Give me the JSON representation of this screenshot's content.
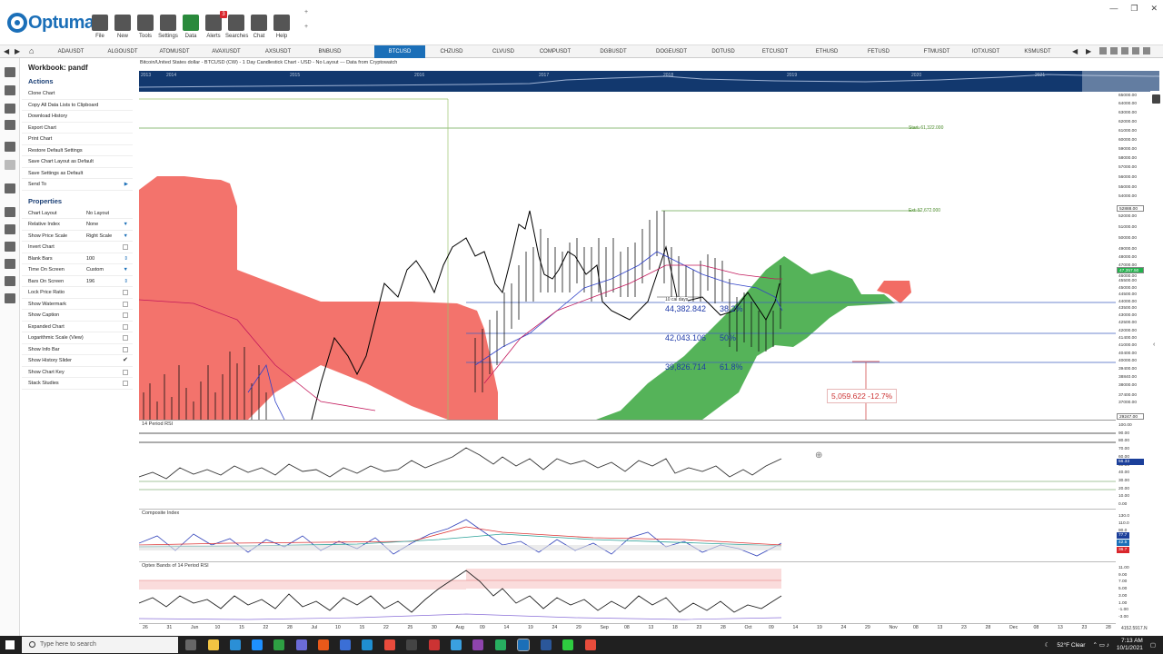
{
  "app": {
    "name": "Optuma"
  },
  "toolbar": {
    "buttons": [
      {
        "label": "File",
        "icon": "folder-icon"
      },
      {
        "label": "New",
        "icon": "new-page-icon"
      },
      {
        "label": "Tools",
        "icon": "tools-icon"
      },
      {
        "label": "Settings",
        "icon": "gear-icon"
      },
      {
        "label": "Data",
        "icon": "data-grid-icon"
      },
      {
        "label": "Alerts",
        "icon": "alarm-clock-icon"
      },
      {
        "label": "Searches",
        "icon": "magnifier-icon"
      },
      {
        "label": "Chat",
        "icon": "chat-bubble-icon"
      },
      {
        "label": "Help",
        "icon": "question-icon"
      }
    ],
    "alerts_count": "3"
  },
  "symbols": [
    "ADAUSDT",
    "ALGOUSDT",
    "ATOMUSDT",
    "AVAXUSDT",
    "AXSUSDT",
    "BNBUSD",
    "BTCUSD",
    "CHZUSD",
    "CLVUSD",
    "COMPUSDT",
    "DGBUSDT",
    "DOGEUSDT",
    "DOTUSD",
    "ETCUSDT",
    "ETHUSD",
    "FETUSD",
    "FTMUSDT",
    "IOTXUSDT",
    "KSMUSDT"
  ],
  "active_symbol": "BTCUSD",
  "panel": {
    "workbook": "Workbook: pandf",
    "actions_heading": "Actions",
    "actions": [
      "Clone Chart",
      "Copy All Data Lists to Clipboard",
      "Download History",
      "Export Chart",
      "Print Chart",
      "Restore Default Settings",
      "Save Chart Layout as Default",
      "Save Settings as Default",
      "Send To"
    ],
    "properties_heading": "Properties",
    "properties": [
      {
        "label": "Chart Layout",
        "value": "No Layout",
        "control": "text"
      },
      {
        "label": "Relative Index",
        "value": "None",
        "control": "dropdown"
      },
      {
        "label": "Show Price Scale",
        "value": "Right Scale",
        "control": "dropdown"
      },
      {
        "label": "Invert Chart",
        "value": "",
        "control": "checkbox",
        "checked": false
      },
      {
        "label": "Blank Bars",
        "value": "100",
        "control": "spinner"
      },
      {
        "label": "Time On Screen",
        "value": "Custom",
        "control": "dropdown"
      },
      {
        "label": "Bars On Screen",
        "value": "196",
        "control": "spinner"
      },
      {
        "label": "Lock Price Ratio",
        "value": "",
        "control": "checkbox",
        "checked": false
      },
      {
        "label": "Show Watermark",
        "value": "",
        "control": "checkbox",
        "checked": false
      },
      {
        "label": "Show Caption",
        "value": "",
        "control": "checkbox",
        "checked": false
      },
      {
        "label": "Expanded Chart",
        "value": "",
        "control": "checkbox",
        "checked": false
      },
      {
        "label": "Logarithmic Scale (View)",
        "value": "",
        "control": "checkbox",
        "checked": false
      },
      {
        "label": "Show Info Bar",
        "value": "",
        "control": "checkbox",
        "checked": false
      },
      {
        "label": "Show History Slider",
        "value": "",
        "control": "checkbox",
        "checked": true
      },
      {
        "label": "Show Chart Key",
        "value": "",
        "control": "checkbox",
        "checked": false
      },
      {
        "label": "Stack Studies",
        "value": "",
        "control": "checkbox",
        "checked": false
      }
    ]
  },
  "chart": {
    "header": "Bitcoin/United States dollar - BTCUSD (CW) - 1 Day Candlestick Chart - USD - No Layout --- Data from Cryptowatch",
    "history_years": [
      "2013",
      "2014",
      "2015",
      "2016",
      "2017",
      "2018",
      "2019",
      "2020",
      "2021"
    ],
    "price_ticks": [
      "65000.00",
      "64000.00",
      "63000.00",
      "62000.00",
      "61000.00",
      "60000.00",
      "59000.00",
      "58000.00",
      "57000.00",
      "56000.00",
      "55000.00",
      "54000.00",
      "53000.00",
      "52000.00",
      "51000.00",
      "50000.00",
      "49000.00",
      "48000.00",
      "47000.00",
      "46500.00",
      "46000.00",
      "45500.00",
      "45000.00",
      "44500.00",
      "44000.00",
      "43500.00",
      "43000.00",
      "42500.00",
      "42000.00",
      "41400.00",
      "41000.00",
      "40400.00",
      "40000.00",
      "39400.00",
      "38840.00",
      "38000.00",
      "37400.00",
      "37000.00"
    ],
    "price_labels": [
      {
        "text": "52888.00",
        "color": "#ffffff",
        "text_color": "#222222"
      },
      {
        "text": "47,357.50",
        "color": "#22b14c",
        "text_color": "#ffffff"
      },
      {
        "text": "29247.00",
        "color": "#ffffff",
        "text_color": "#222222"
      }
    ],
    "levels": {
      "start": "Start: 61,322.000",
      "ext": "Ext: 52,672.000"
    },
    "fib_levels": [
      {
        "price": "44,382.842",
        "pct": "38.2%"
      },
      {
        "price": "42,043.106",
        "pct": "50%"
      },
      {
        "price": "39,826.714",
        "pct": "61.8%"
      }
    ],
    "measure": "10 cal days",
    "drawdown": "5,059.622 -12.7%",
    "rsi": {
      "title": "14 Period RSI",
      "ticks": [
        "100.00",
        "90.00",
        "80.00",
        "70.00",
        "60.00",
        "50.00",
        "40.00",
        "30.00",
        "20.00",
        "10.00",
        "0.00"
      ],
      "current": "56.33"
    },
    "composite": {
      "title": "Composite Index",
      "ticks": [
        "130.0",
        "110.0",
        "90.0",
        "70.0",
        "50.0",
        "30.0"
      ],
      "values": [
        "77.7",
        "42.5",
        "36.7"
      ]
    },
    "optex": {
      "title": "Optex Bands of 14 Period RSI",
      "ticks": [
        "11.00",
        "9.00",
        "7.00",
        "5.00",
        "3.00",
        "1.00",
        "-1.00",
        "-3.00"
      ]
    },
    "date_ticks": [
      "26",
      "31",
      "Jun",
      "10",
      "15",
      "22",
      "28",
      "Jul",
      "10",
      "15",
      "22",
      "25",
      "30",
      "Aug",
      "09",
      "14",
      "19",
      "24",
      "29",
      "Sep",
      "08",
      "13",
      "18",
      "23",
      "28",
      "Oct",
      "09",
      "14",
      "19",
      "24",
      "29",
      "Nov",
      "08",
      "13",
      "23",
      "28",
      "Dec",
      "08",
      "13",
      "23",
      "28"
    ],
    "date_end": "4152.5917.N"
  },
  "taskbar": {
    "search_placeholder": "Type here to search",
    "weather": "52°F Clear",
    "time": "7:13 AM",
    "date": "10/1/2021"
  }
}
